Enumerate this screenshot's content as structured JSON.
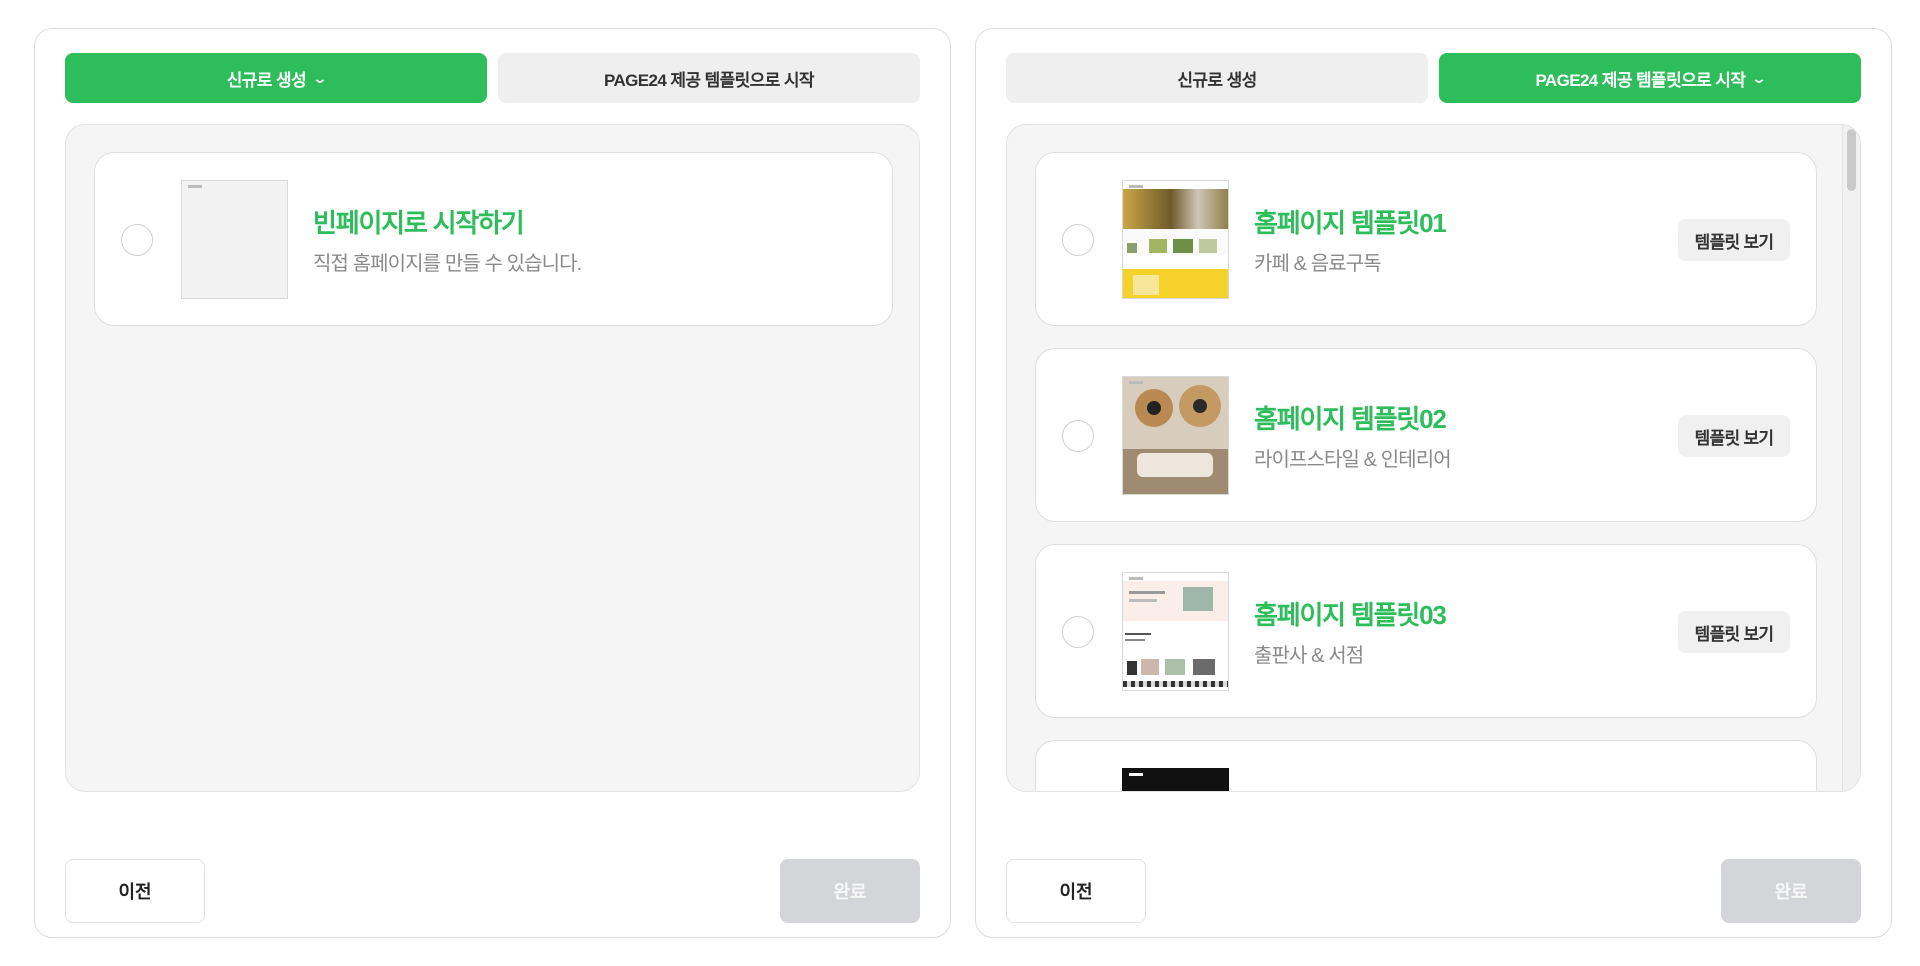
{
  "left_panel": {
    "tabs": [
      {
        "label": "신규로 생성",
        "active": true
      },
      {
        "label": "PAGE24 제공 템플릿으로 시작",
        "active": false
      }
    ],
    "cards": [
      {
        "title": "빈페이지로 시작하기",
        "subtitle": "직접 홈페이지를 만들 수 있습니다."
      }
    ],
    "footer": {
      "prev_label": "이전",
      "done_label": "완료"
    }
  },
  "right_panel": {
    "tabs": [
      {
        "label": "신규로 생성",
        "active": false
      },
      {
        "label": "PAGE24 제공 템플릿으로 시작",
        "active": true
      }
    ],
    "cards": [
      {
        "title": "홈페이지 템플릿01",
        "subtitle": "카페 & 음료구독",
        "button": "템플릿 보기"
      },
      {
        "title": "홈페이지 템플릿02",
        "subtitle": "라이프스타일 & 인테리어",
        "button": "템플릿 보기"
      },
      {
        "title": "홈페이지 템플릿03",
        "subtitle": "출판사 & 서점",
        "button": "템플릿 보기"
      },
      {
        "title": "",
        "subtitle": "",
        "button": ""
      }
    ],
    "footer": {
      "prev_label": "이전",
      "done_label": "완료"
    }
  },
  "colors": {
    "accent": "#2dbd5a",
    "tab_inactive": "#efefef",
    "disabled": "#d4d5d8"
  },
  "icons": {
    "tab_chevron": "chevron-down-icon"
  }
}
